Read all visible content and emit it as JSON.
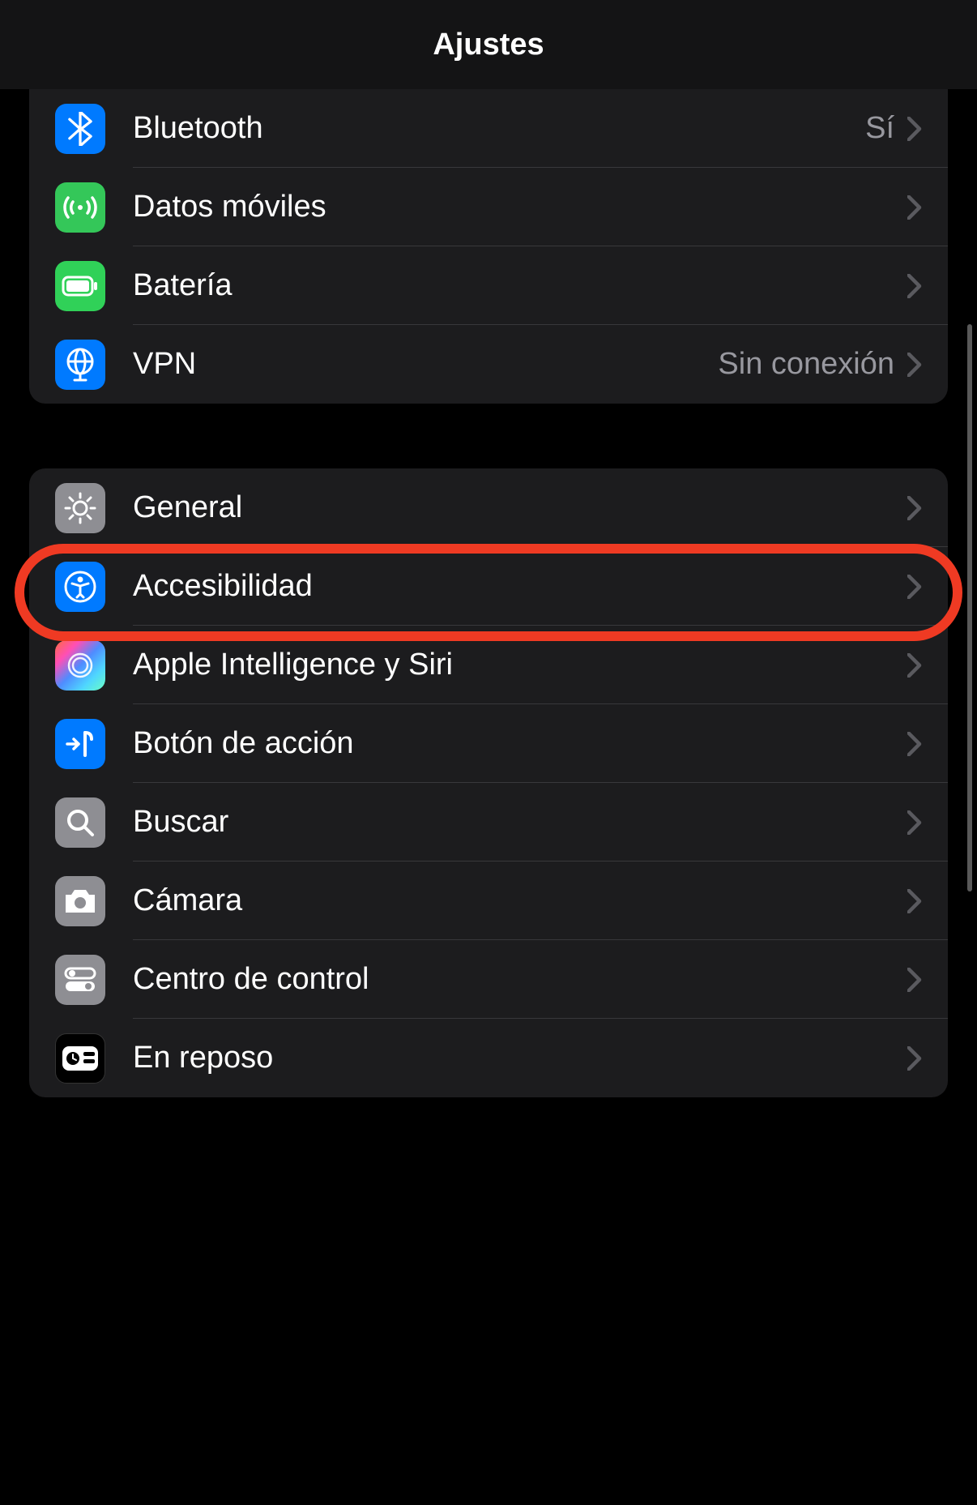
{
  "header": {
    "title": "Ajustes"
  },
  "groups": [
    {
      "items": [
        {
          "id": "bluetooth",
          "label": "Bluetooth",
          "value": "Sí",
          "icon": "bluetooth-icon",
          "color": "ic-blue"
        },
        {
          "id": "mobile-data",
          "label": "Datos móviles",
          "value": "",
          "icon": "antenna-icon",
          "color": "ic-green"
        },
        {
          "id": "battery",
          "label": "Batería",
          "value": "",
          "icon": "battery-icon",
          "color": "ic-gr2"
        },
        {
          "id": "vpn",
          "label": "VPN",
          "value": "Sin conexión",
          "icon": "globe-icon",
          "color": "ic-blue"
        }
      ]
    },
    {
      "items": [
        {
          "id": "general",
          "label": "General",
          "value": "",
          "icon": "gear-icon",
          "color": "ic-gray"
        },
        {
          "id": "accessibility",
          "label": "Accesibilidad",
          "value": "",
          "icon": "accessibility-icon",
          "color": "ic-blue",
          "highlighted": true
        },
        {
          "id": "apple-intelligence-siri",
          "label": "Apple Intelligence y Siri",
          "value": "",
          "icon": "siri-icon",
          "color": "ic-gradient"
        },
        {
          "id": "action-button",
          "label": "Botón de acción",
          "value": "",
          "icon": "action-icon",
          "color": "ic-blue"
        },
        {
          "id": "search",
          "label": "Buscar",
          "value": "",
          "icon": "search-icon",
          "color": "ic-gray"
        },
        {
          "id": "camera",
          "label": "Cámara",
          "value": "",
          "icon": "camera-icon",
          "color": "ic-gray"
        },
        {
          "id": "control-center",
          "label": "Centro de control",
          "value": "",
          "icon": "toggles-icon",
          "color": "ic-gray"
        },
        {
          "id": "standby",
          "label": "En reposo",
          "value": "",
          "icon": "standby-icon",
          "color": "ic-black"
        }
      ]
    }
  ]
}
